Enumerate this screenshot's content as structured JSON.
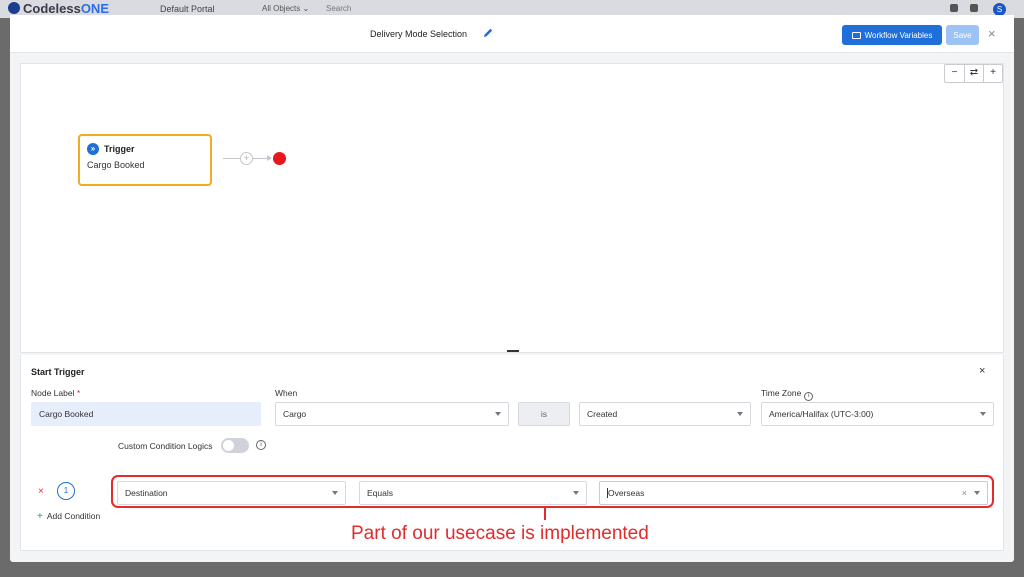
{
  "background_app": {
    "logo_main": "Codeless",
    "logo_suffix": "ONE",
    "portal": "Default Portal",
    "all_objects": "All Objects ⌄",
    "search": "Search",
    "avatar_initial": "S"
  },
  "modal": {
    "title": "Delivery Mode Selection",
    "workflow_variables_label": "Workflow Variables",
    "save_label": "Save",
    "close_glyph": "×"
  },
  "canvas": {
    "zoom_out": "−",
    "reset": "⇄",
    "zoom_in": "+",
    "trigger_node": {
      "icon_glyph": "»",
      "title": "Trigger",
      "subtitle": "Cargo Booked"
    },
    "add_node_glyph": "+"
  },
  "panel": {
    "title": "Start Trigger",
    "close_glyph": "×",
    "node_label": {
      "label": "Node Label",
      "required_mark": "*",
      "value": "Cargo Booked"
    },
    "when": {
      "label": "When",
      "object_value": "Cargo",
      "operator": "is",
      "event_value": "Created"
    },
    "time_zone": {
      "label": "Time Zone",
      "value": "America/Halifax (UTC-3:00)"
    },
    "custom_condition_logics": {
      "label": "Custom Condition Logics",
      "enabled": false
    },
    "info_glyph": "i",
    "conditions": [
      {
        "number": "1",
        "field": "Destination",
        "operator": "Equals",
        "value": "Overseas",
        "remove_glyph": "×",
        "clear_glyph": "×"
      }
    ],
    "add_condition_label": "Add Condition",
    "add_glyph": "+"
  },
  "annotation": {
    "text": "Part of our usecase is implemented",
    "color": "#e22b2b"
  },
  "colors": {
    "primary": "#1e6fd9",
    "trigger_border": "#f0ab25",
    "end_node": "#e8161d"
  }
}
